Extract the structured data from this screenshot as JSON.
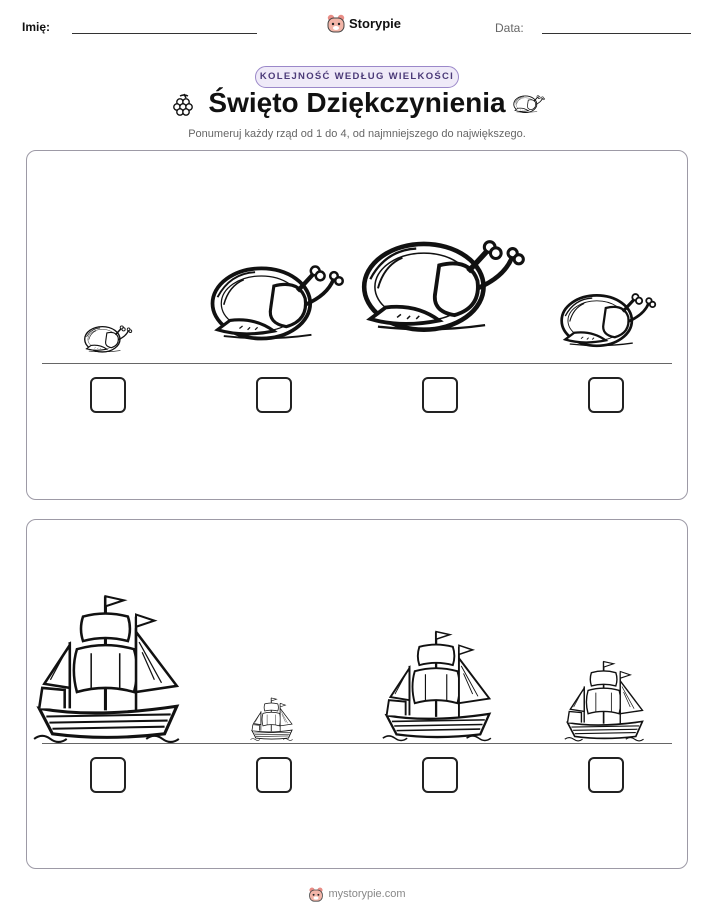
{
  "header": {
    "name_label": "Imię:",
    "date_label": "Data:",
    "brand": "Storypie"
  },
  "badge": "KOLEJNOŚĆ WEDŁUG WIELKOŚCI",
  "title": "Święto Dziękczynienia",
  "instructions": "Ponumeruj każdy rząd od 1 do 4, od najmniejszego do największego.",
  "rows": [
    {
      "item": "turkey-icon",
      "scales": [
        0.3,
        0.8,
        1.0,
        0.55
      ],
      "answers": [
        "",
        "",
        "",
        ""
      ]
    },
    {
      "item": "ship-icon",
      "scales": [
        1.0,
        0.28,
        0.7,
        0.52
      ],
      "answers": [
        "",
        "",
        "",
        ""
      ]
    }
  ],
  "footer": "mystorypie.com"
}
